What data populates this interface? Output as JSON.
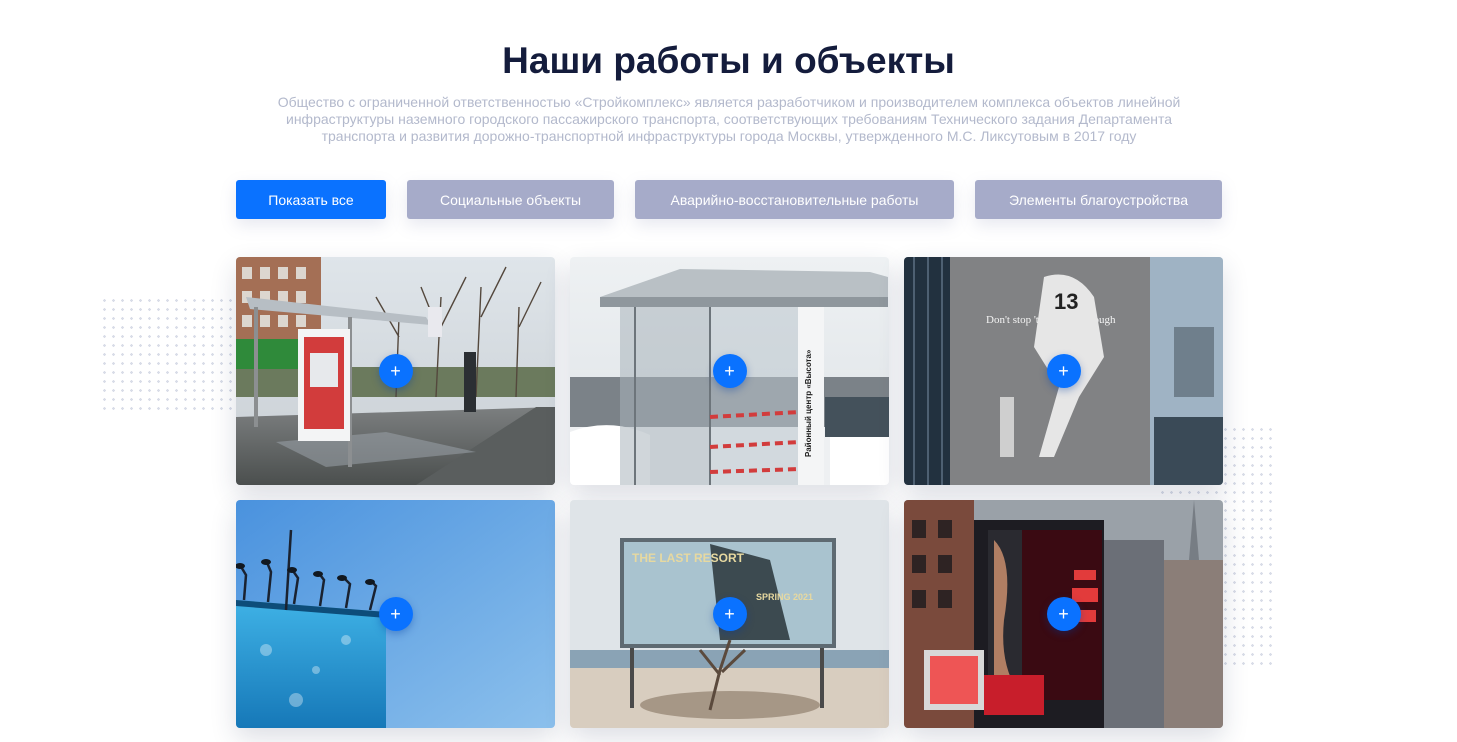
{
  "header": {
    "title": "Наши работы и объекты",
    "description": "Общество с ограниченной ответственностью «Стройкомплекс» является разработчиком и производителем комплекса объектов линейной инфраструктуры наземного городского пассажирского транспорта, соответствующих требованиям Технического задания Департамента транспорта и развития дорожно-транспортной инфраструктуры города Москвы, утвержденного М.С. Ликсутовым в 2017 году"
  },
  "filters": [
    {
      "label": "Показать все",
      "active": true
    },
    {
      "label": "Социальные объекты",
      "active": false
    },
    {
      "label": "Аварийно-восстановительные работы",
      "active": false
    },
    {
      "label": "Элементы благоустройства",
      "active": false
    }
  ],
  "gallery": {
    "expand_icon": "plus-icon",
    "items": [
      {
        "icon": "plus-icon",
        "symbol": "+"
      },
      {
        "icon": "plus-icon",
        "symbol": "+"
      },
      {
        "icon": "plus-icon",
        "symbol": "+"
      },
      {
        "icon": "plus-icon",
        "symbol": "+"
      },
      {
        "icon": "plus-icon",
        "symbol": "+"
      },
      {
        "icon": "plus-icon",
        "symbol": "+"
      }
    ],
    "photo_text": {
      "stop_sign": "Районный центр «Высота»",
      "billboard_slogan": "Don't stop 'til you get enough",
      "jersey_number": "13",
      "resort_title": "THE LAST RESORT",
      "resort_date": "SPRING 2021"
    }
  },
  "colors": {
    "accent": "#0a72ff",
    "inactive_filter": "#a6abc9",
    "title": "#141c3c",
    "description": "#b3b9cc"
  }
}
